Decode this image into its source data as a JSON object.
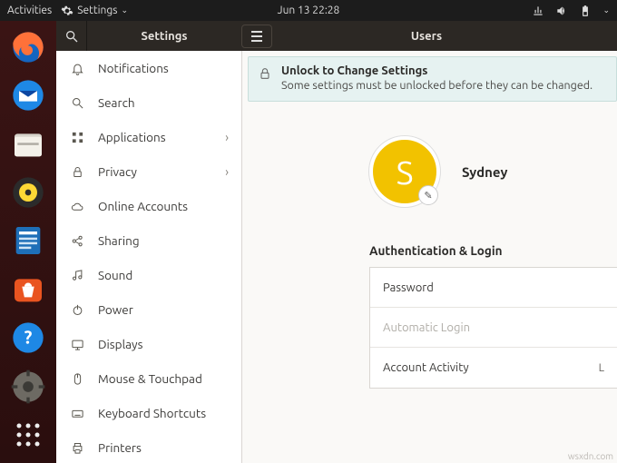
{
  "topbar": {
    "activities": "Activities",
    "app_menu": "Settings",
    "clock": "Jun 13  22:28"
  },
  "window": {
    "sidebar_title": "Settings",
    "panel_title": "Users"
  },
  "sidebar": {
    "items": [
      {
        "label": "Notifications"
      },
      {
        "label": "Search"
      },
      {
        "label": "Applications",
        "expand": true
      },
      {
        "label": "Privacy",
        "expand": true
      },
      {
        "label": "Online Accounts"
      },
      {
        "label": "Sharing"
      },
      {
        "label": "Sound"
      },
      {
        "label": "Power"
      },
      {
        "label": "Displays"
      },
      {
        "label": "Mouse & Touchpad"
      },
      {
        "label": "Keyboard Shortcuts"
      },
      {
        "label": "Printers"
      }
    ]
  },
  "unlock": {
    "title": "Unlock to Change Settings",
    "body": "Some settings must be unlocked before they can be changed."
  },
  "user": {
    "initial": "S",
    "name": "Sydney"
  },
  "auth": {
    "section": "Authentication & Login",
    "password": "Password",
    "autolog": "Automatic Login",
    "activity": "Account Activity",
    "activity_value": "L"
  },
  "watermark": "wsxdn.com"
}
